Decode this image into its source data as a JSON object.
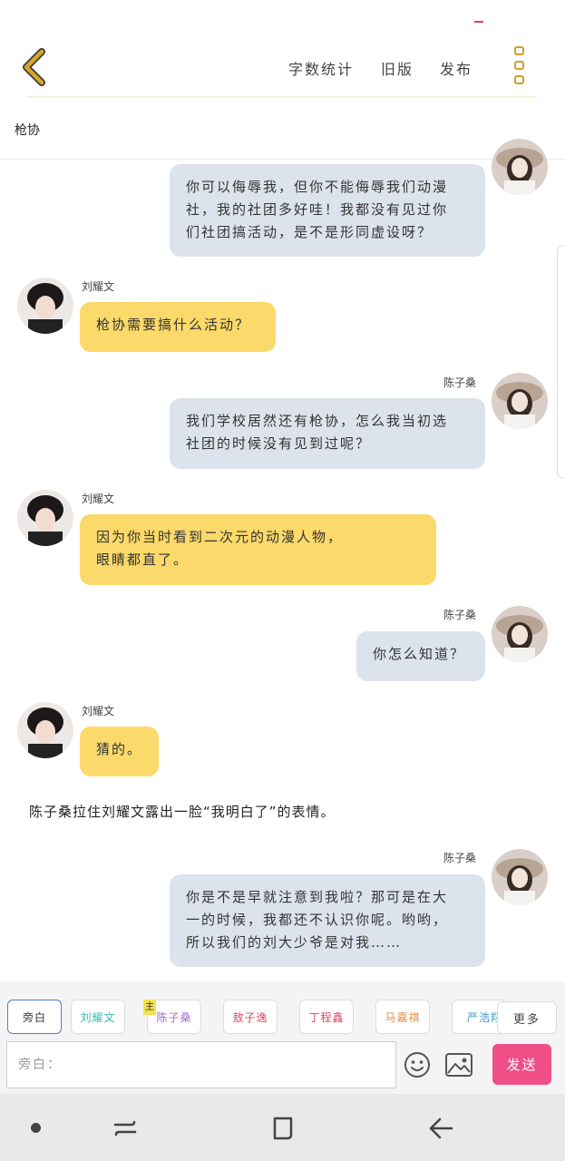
{
  "header": {
    "back_icon": "chevron-left-icon",
    "word_count": "字数统计",
    "old_version": "旧版",
    "publish": "发布",
    "more_icon": "more-vertical-icon",
    "title": "枪协"
  },
  "colors": {
    "accent_yellow": "#fbd96a",
    "bubble_gray": "#dde3ec",
    "send_pink": "#ee4f87",
    "back_arrow": "#d4a72a"
  },
  "messages": [
    {
      "side": "right",
      "speaker": "",
      "lines": [
        "你可以侮辱我，但你不能侮辱我们动漫",
        "社，我的社团多好哇！我都没有见过你",
        "们社团搞活动，是不是形同虚设呀？"
      ]
    },
    {
      "side": "left",
      "speaker": "刘耀文",
      "lines": [
        "枪协需要搞什么活动？"
      ]
    },
    {
      "side": "right",
      "speaker": "陈子桑",
      "lines": [
        "我们学校居然还有枪协，怎么我当初选",
        "社团的时候没有见到过呢？"
      ]
    },
    {
      "side": "left",
      "speaker": "刘耀文",
      "lines": [
        "因为你当时看到二次元的动漫人物，",
        "眼睛都直了。"
      ]
    },
    {
      "side": "right",
      "speaker": "陈子桑",
      "lines": [
        "你怎么知道？"
      ]
    },
    {
      "side": "left",
      "speaker": "刘耀文",
      "lines": [
        "猜的。"
      ]
    },
    {
      "side": "narration",
      "text": "陈子桑拉住刘耀文露出一脸“我明白了”的表情。"
    },
    {
      "side": "right",
      "speaker": "陈子桑",
      "lines": [
        "你是不是早就注意到我啦？那可是在大",
        "一的时候，我都还不认识你呢。哟哟，",
        "所以我们的刘大少爷是对我……"
      ]
    }
  ],
  "characters": {
    "chips": [
      {
        "label": "旁白",
        "color": "#333333",
        "selected": true
      },
      {
        "label": "刘耀文",
        "color": "#3bb8b0",
        "selected": false
      },
      {
        "label": "陈子桑",
        "color": "#a46cc9",
        "selected": false,
        "main_badge": "主"
      },
      {
        "label": "敖子逸",
        "color": "#e2445c",
        "selected": false
      },
      {
        "label": "丁程鑫",
        "color": "#e2445c",
        "selected": false
      },
      {
        "label": "马嘉祺",
        "color": "#e88a3a",
        "selected": false
      },
      {
        "label": "严浩翔",
        "color": "#3a9ad9",
        "selected": false
      }
    ],
    "more": "更多"
  },
  "composer": {
    "placeholder": "旁白：",
    "emoji_icon": "smiley-icon",
    "image_icon": "image-icon",
    "send": "发送"
  },
  "navbar": {
    "home_dot_icon": "dot-icon",
    "recent_icon": "recent-apps-icon",
    "home_icon": "home-square-icon",
    "back_icon": "back-arrow-icon"
  }
}
